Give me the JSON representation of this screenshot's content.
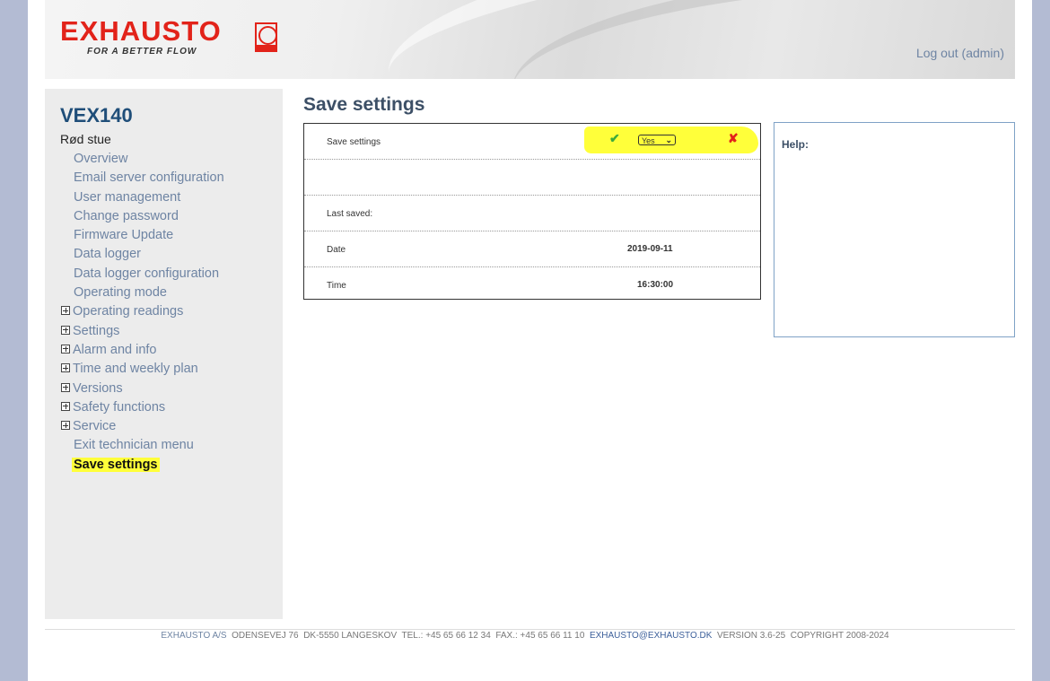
{
  "header": {
    "brand": "EXHAUSTO",
    "tagline": "FOR A BETTER FLOW",
    "logout": "Log out (admin)"
  },
  "sidebar": {
    "device": "VEX140",
    "room": "Rød stue",
    "items": [
      {
        "label": "Overview"
      },
      {
        "label": "Email server configuration"
      },
      {
        "label": "User management"
      },
      {
        "label": "Change password"
      },
      {
        "label": "Firmware Update"
      },
      {
        "label": "Data logger"
      },
      {
        "label": "Data logger configuration"
      },
      {
        "label": "Operating mode"
      },
      {
        "label": "Operating readings"
      },
      {
        "label": "Settings"
      },
      {
        "label": "Alarm and info"
      },
      {
        "label": "Time and weekly plan"
      },
      {
        "label": "Versions"
      },
      {
        "label": "Safety functions"
      },
      {
        "label": "Service"
      },
      {
        "label": "Exit technician menu"
      },
      {
        "label": "Save settings"
      }
    ]
  },
  "main": {
    "title": "Save settings",
    "save_label": "Save settings",
    "select_value": "Yes",
    "last_saved_label": "Last saved:",
    "date_label": "Date",
    "date_value": "2019-09-11",
    "time_label": "Time",
    "time_value": "16:30:00"
  },
  "help": {
    "title": "Help:"
  },
  "footer": {
    "company": "EXHAUSTO A/S",
    "address": "ODENSEVEJ 76",
    "city": "DK-5550 LANGESKOV",
    "tel": "TEL.: +45 65 66 12 34",
    "fax": "FAX.: +45 65 66 11 10",
    "email": "EXHAUSTO@EXHAUSTO.DK",
    "version": "VERSION 3.6-25",
    "copyright": "COPYRIGHT 2008-2024"
  },
  "colors": {
    "brand_red": "#e2231a",
    "link": "#6e84a3",
    "heading": "#1f4e79",
    "highlight": "#ffff3a"
  }
}
